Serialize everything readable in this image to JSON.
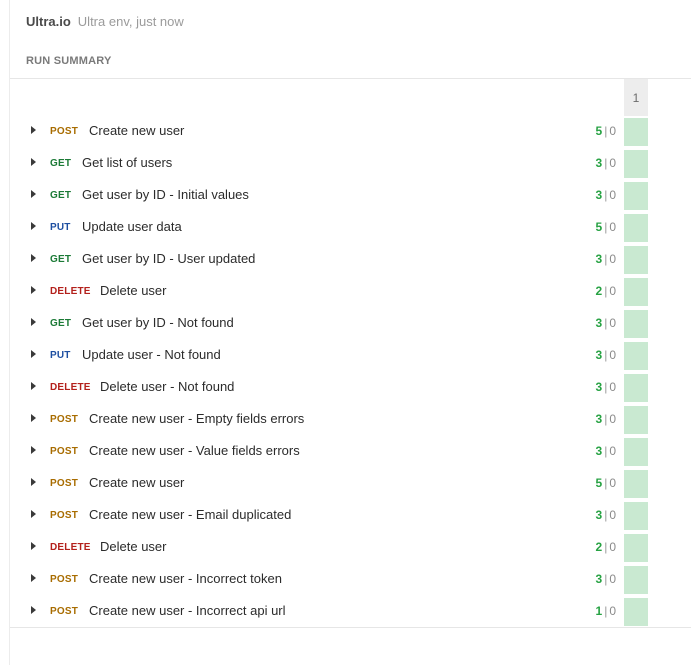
{
  "header": {
    "app_name": "Ultra.io",
    "environment": "Ultra env, just now"
  },
  "section_title": "RUN SUMMARY",
  "column_header": "1",
  "colors": {
    "post": "#a86c00",
    "get": "#1b7a36",
    "put": "#1e4fa1",
    "delete": "#b3201b",
    "pass_cell": "#c9e9d1"
  },
  "requests": [
    {
      "method": "POST",
      "name": "Create new user",
      "passed": "5",
      "failed": "0"
    },
    {
      "method": "GET",
      "name": "Get list of users",
      "passed": "3",
      "failed": "0"
    },
    {
      "method": "GET",
      "name": "Get user by ID - Initial values",
      "passed": "3",
      "failed": "0"
    },
    {
      "method": "PUT",
      "name": "Update user data",
      "passed": "5",
      "failed": "0"
    },
    {
      "method": "GET",
      "name": "Get user by ID - User updated",
      "passed": "3",
      "failed": "0"
    },
    {
      "method": "DELETE",
      "name": "Delete user",
      "passed": "2",
      "failed": "0"
    },
    {
      "method": "GET",
      "name": "Get user by ID - Not found",
      "passed": "3",
      "failed": "0"
    },
    {
      "method": "PUT",
      "name": "Update user - Not found",
      "passed": "3",
      "failed": "0"
    },
    {
      "method": "DELETE",
      "name": "Delete user - Not found",
      "passed": "3",
      "failed": "0"
    },
    {
      "method": "POST",
      "name": "Create new user - Empty fields errors",
      "passed": "3",
      "failed": "0"
    },
    {
      "method": "POST",
      "name": "Create new user - Value fields errors",
      "passed": "3",
      "failed": "0"
    },
    {
      "method": "POST",
      "name": "Create new user",
      "passed": "5",
      "failed": "0"
    },
    {
      "method": "POST",
      "name": "Create new user - Email duplicated",
      "passed": "3",
      "failed": "0"
    },
    {
      "method": "DELETE",
      "name": "Delete user",
      "passed": "2",
      "failed": "0"
    },
    {
      "method": "POST",
      "name": "Create new user - Incorrect token",
      "passed": "3",
      "failed": "0"
    },
    {
      "method": "POST",
      "name": "Create new user - Incorrect api url",
      "passed": "1",
      "failed": "0"
    }
  ]
}
